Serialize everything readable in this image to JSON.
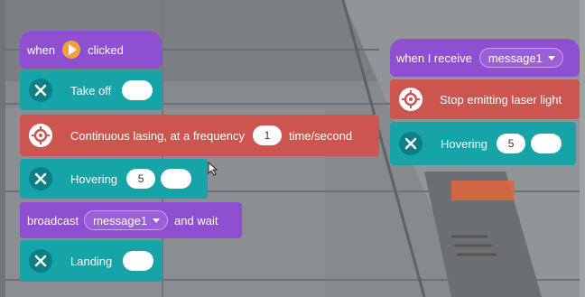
{
  "script_left": {
    "when_clicked": {
      "when_label": "when",
      "clicked_label": "clicked",
      "flag_icon": "play-flag-icon"
    },
    "take_off": {
      "label": "Take off",
      "value": ""
    },
    "continuous_lasing": {
      "label": "Continuous lasing, at a frequency",
      "frequency": "1",
      "unit": "time/second"
    },
    "hovering": {
      "label": "Hovering",
      "seconds": "5",
      "value": ""
    },
    "broadcast": {
      "label": "broadcast",
      "message": "message1",
      "suffix": "and wait"
    },
    "landing": {
      "label": "Landing",
      "value": ""
    }
  },
  "script_right": {
    "when_receive": {
      "label": "when I receive",
      "message": "message1"
    },
    "stop_laser": {
      "label": "Stop emitting laser light"
    },
    "hovering": {
      "label": "Hovering",
      "seconds": "5",
      "value": ""
    }
  },
  "colors": {
    "event": "#8f4fd1",
    "drone": "#17a4a9",
    "laser": "#cc5550"
  }
}
